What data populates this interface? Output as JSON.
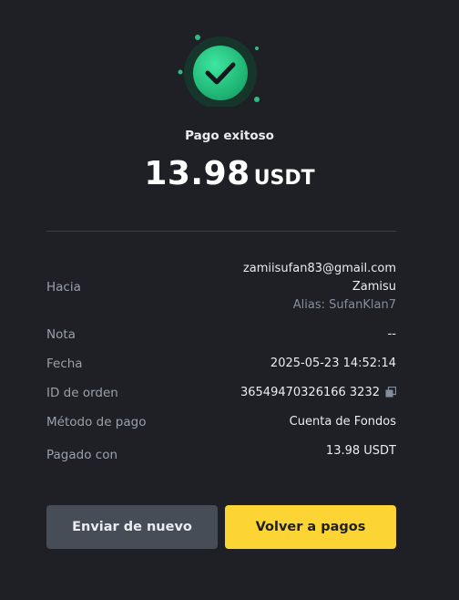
{
  "status": {
    "title": "Pago exitoso",
    "icon": "check-circle-icon",
    "accent_color": "#2ebd85"
  },
  "amount": {
    "value": "13.98",
    "currency": "USDT"
  },
  "details": {
    "to": {
      "label": "Hacia",
      "email": "zamiisufan83@gmail.com",
      "name": "Zamisu",
      "alias": "Alias: SufanKlan7"
    },
    "note": {
      "label": "Nota",
      "value": "--"
    },
    "date": {
      "label": "Fecha",
      "value": "2025-05-23 14:52:14"
    },
    "order_id": {
      "label": "ID de orden",
      "value": "36549470326166 3232",
      "copy_icon": "copy-icon"
    },
    "payment_method": {
      "label": "Método de pago",
      "value": "Cuenta de Fondos"
    },
    "paid_with": {
      "label": "Pagado con",
      "value": "13.98 USDT"
    }
  },
  "actions": {
    "send_again_label": "Enviar de nuevo",
    "back_label": "Volver a pagos",
    "primary_color": "#fcd535",
    "secondary_color": "#474d57"
  }
}
